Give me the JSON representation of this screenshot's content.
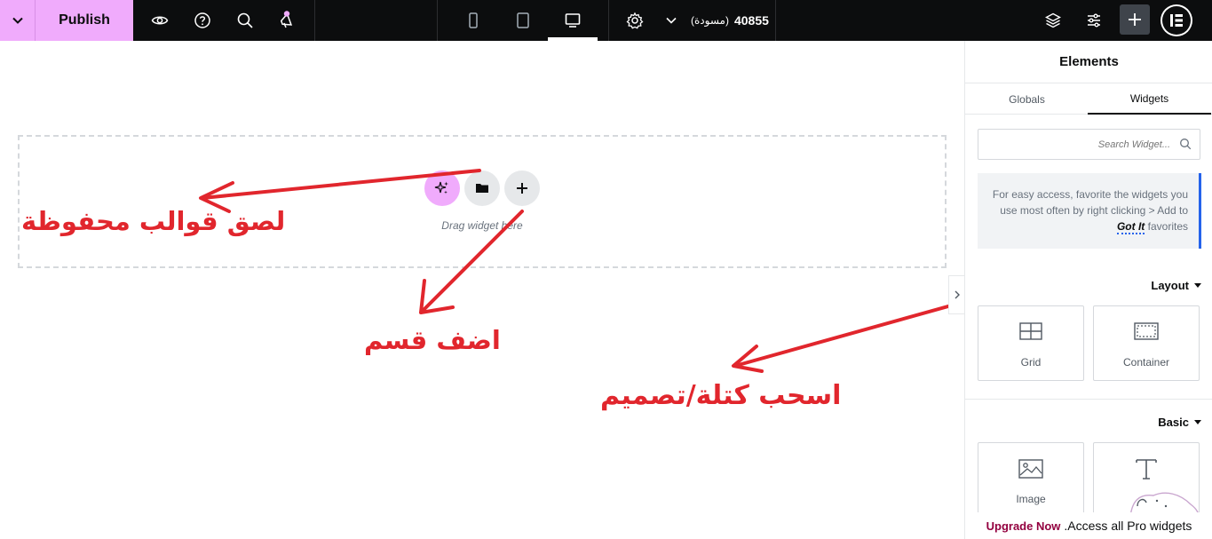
{
  "topbar": {
    "publish_label": "Publish",
    "doc_id": "40855",
    "doc_status": "(مسودة)",
    "icons": [
      "chevron-down-icon",
      "eye-icon",
      "help-icon",
      "search-icon",
      "megaphone-icon",
      "mobile-icon",
      "tablet-icon",
      "desktop-icon",
      "gear-icon",
      "layers-icon",
      "sliders-icon",
      "plus-icon",
      "elementor-logo"
    ],
    "accent_color": "#f0abfc",
    "notification_dot_color": "#f0abfc"
  },
  "canvas": {
    "drop_label": "Drag widget here",
    "buttons": [
      "ai-sparkle-icon",
      "folder-icon",
      "plus-icon"
    ],
    "annotations": [
      {
        "text": "لصق قوالب محفوظة"
      },
      {
        "text": "اضف قسم"
      },
      {
        "text": "اسحب كتلة/تصميم"
      }
    ],
    "annotation_color": "#e1262d"
  },
  "panel": {
    "title": "Elements",
    "tabs": [
      {
        "label": "Globals",
        "active": false
      },
      {
        "label": "Widgets",
        "active": true
      }
    ],
    "search_placeholder": "Search Widget...",
    "tip": {
      "text_line1": "For easy access, favorite the widgets you",
      "text_line2": "use most often by right clicking > Add to",
      "got_it": "Got It",
      "text_line3_end": "favorites"
    },
    "sections": [
      {
        "title": "Layout",
        "widgets": [
          {
            "label": "Grid",
            "icon": "grid-icon"
          },
          {
            "label": "Container",
            "icon": "container-icon"
          }
        ]
      },
      {
        "title": "Basic",
        "widgets": [
          {
            "label": "Image",
            "icon": "image-icon"
          },
          {
            "label": "",
            "icon": "text-icon"
          }
        ]
      }
    ],
    "pro_bar": {
      "upgrade": "Upgrade Now",
      "text": ".Access all Pro widgets"
    }
  }
}
